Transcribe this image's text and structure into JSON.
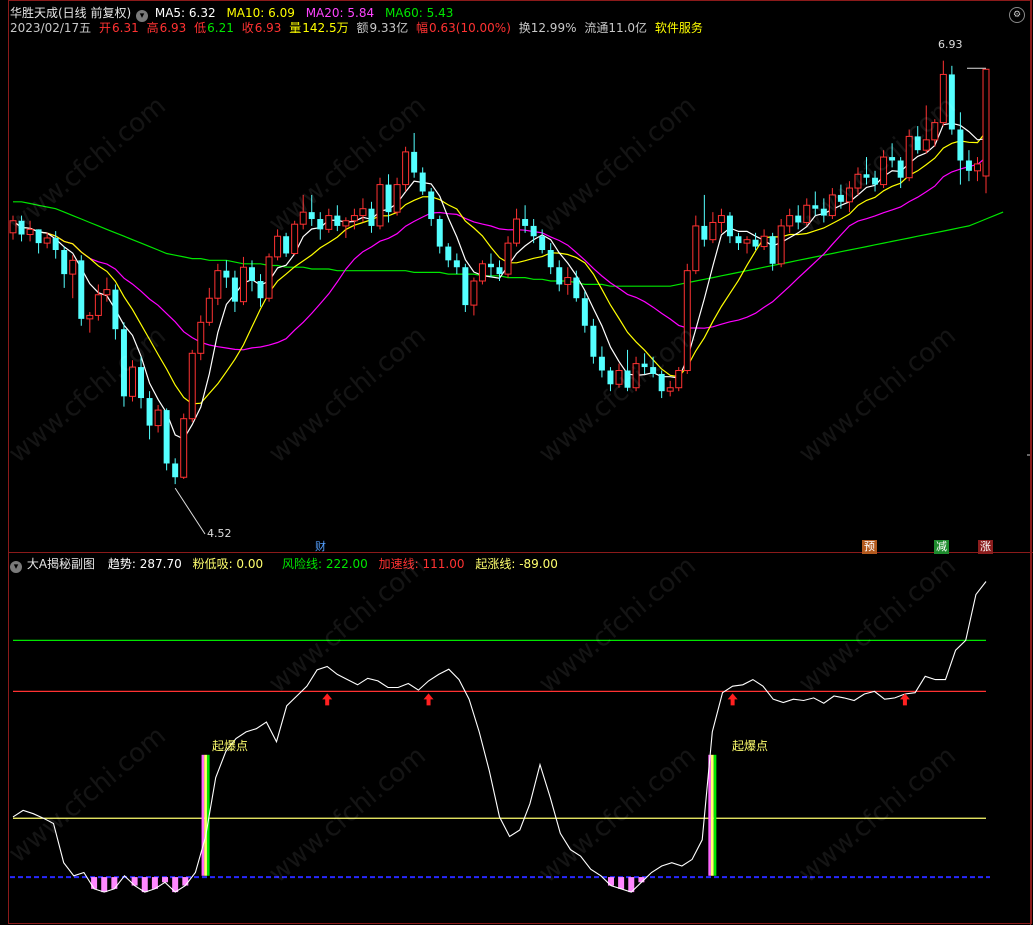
{
  "main_header": {
    "title": "华胜天成(日线 前复权)",
    "ma5": "MA5: 6.32",
    "ma10": "MA10: 6.09",
    "ma20": "MA20: 5.84",
    "ma60": "MA60: 5.43",
    "date": "2023/02/17五",
    "open_label": "开",
    "open": "6.31",
    "high_label": "高",
    "high": "6.93",
    "low_label": "低",
    "low": "6.21",
    "close_label": "收",
    "close": "6.93",
    "vol_label": "量",
    "vol": "142.5万",
    "amt_label": "额",
    "amt": "9.33亿",
    "chg_label": "幅",
    "chg": "0.63(10.00%)",
    "turnover": "换12.99%",
    "float": "流通11.0亿",
    "service": "软件服务"
  },
  "markers": {
    "high_price": "6.93",
    "low_price": "4.52",
    "cai": "财",
    "yu": "预",
    "jian": "减",
    "zhang": "涨"
  },
  "sub_header": {
    "title": "大A揭秘副图",
    "trend": "趋势: 287.70",
    "pink": "粉低吸: 0.00",
    "risk": "风险线: 222.00",
    "accel": "加速线: 111.00",
    "rise": "起涨线: -89.00"
  },
  "signals": {
    "qibao1": "起爆点",
    "qibao2": "起爆点"
  },
  "watermark": "www.cfchi.com",
  "colors": {
    "up": "#ff3232",
    "down": "#54ffff",
    "ma5": "#ffffff",
    "ma10": "#ffff00",
    "ma20": "#ff00ff",
    "ma60": "#00e600",
    "risk": "#00e600",
    "accel": "#ff3232",
    "rise": "#ffff6e"
  },
  "chart_data": [
    {
      "type": "candlestick",
      "title": "华胜天成(日线 前复权)",
      "ylim": [
        4.3,
        7.1
      ],
      "series": [
        {
          "name": "K",
          "ohlc": [
            [
              5.98,
              6.08,
              5.94,
              6.05
            ],
            [
              6.05,
              6.08,
              5.93,
              5.97
            ],
            [
              5.97,
              6.05,
              5.93,
              6.0
            ],
            [
              6.0,
              6.0,
              5.86,
              5.92
            ],
            [
              5.92,
              5.98,
              5.89,
              5.95
            ],
            [
              5.95,
              5.99,
              5.83,
              5.88
            ],
            [
              5.88,
              5.9,
              5.66,
              5.74
            ],
            [
              5.74,
              5.85,
              5.6,
              5.82
            ],
            [
              5.82,
              5.85,
              5.44,
              5.48
            ],
            [
              5.48,
              5.52,
              5.4,
              5.5
            ],
            [
              5.5,
              5.68,
              5.47,
              5.62
            ],
            [
              5.62,
              5.72,
              5.58,
              5.65
            ],
            [
              5.65,
              5.68,
              5.36,
              5.42
            ],
            [
              5.42,
              5.46,
              4.97,
              5.03
            ],
            [
              5.03,
              5.24,
              5.0,
              5.2
            ],
            [
              5.2,
              5.26,
              4.96,
              5.02
            ],
            [
              5.02,
              5.06,
              4.78,
              4.86
            ],
            [
              4.86,
              4.98,
              4.82,
              4.95
            ],
            [
              4.95,
              4.96,
              4.6,
              4.64
            ],
            [
              4.64,
              4.67,
              4.52,
              4.56
            ],
            [
              4.56,
              4.93,
              4.55,
              4.9
            ],
            [
              4.9,
              5.3,
              4.88,
              5.28
            ],
            [
              5.28,
              5.5,
              5.24,
              5.46
            ],
            [
              5.46,
              5.66,
              5.44,
              5.6
            ],
            [
              5.6,
              5.8,
              5.56,
              5.76
            ],
            [
              5.76,
              5.82,
              5.66,
              5.72
            ],
            [
              5.72,
              5.76,
              5.52,
              5.58
            ],
            [
              5.58,
              5.84,
              5.56,
              5.78
            ],
            [
              5.78,
              5.82,
              5.64,
              5.7
            ],
            [
              5.7,
              5.74,
              5.55,
              5.6
            ],
            [
              5.6,
              5.86,
              5.58,
              5.84
            ],
            [
              5.84,
              6.0,
              5.82,
              5.96
            ],
            [
              5.96,
              5.98,
              5.84,
              5.86
            ],
            [
              5.86,
              6.05,
              5.85,
              6.03
            ],
            [
              6.03,
              6.2,
              6.0,
              6.1
            ],
            [
              6.1,
              6.2,
              6.02,
              6.06
            ],
            [
              6.06,
              6.1,
              5.94,
              6.0
            ],
            [
              6.0,
              6.12,
              5.98,
              6.08
            ],
            [
              6.08,
              6.14,
              5.99,
              6.02
            ],
            [
              6.02,
              6.07,
              5.95,
              6.05
            ],
            [
              6.05,
              6.12,
              6.0,
              6.08
            ],
            [
              6.08,
              6.18,
              6.04,
              6.12
            ],
            [
              6.12,
              6.16,
              5.98,
              6.02
            ],
            [
              6.02,
              6.3,
              6.0,
              6.26
            ],
            [
              6.26,
              6.32,
              6.04,
              6.1
            ],
            [
              6.1,
              6.3,
              6.08,
              6.26
            ],
            [
              6.26,
              6.48,
              6.22,
              6.45
            ],
            [
              6.45,
              6.56,
              6.3,
              6.33
            ],
            [
              6.33,
              6.36,
              6.2,
              6.22
            ],
            [
              6.22,
              6.24,
              6.02,
              6.06
            ],
            [
              6.06,
              6.08,
              5.86,
              5.9
            ],
            [
              5.9,
              5.92,
              5.78,
              5.82
            ],
            [
              5.82,
              5.86,
              5.74,
              5.78
            ],
            [
              5.78,
              5.8,
              5.52,
              5.56
            ],
            [
              5.56,
              5.72,
              5.5,
              5.7
            ],
            [
              5.7,
              5.82,
              5.68,
              5.8
            ],
            [
              5.8,
              5.86,
              5.72,
              5.78
            ],
            [
              5.78,
              5.82,
              5.7,
              5.74
            ],
            [
              5.74,
              5.96,
              5.72,
              5.92
            ],
            [
              5.92,
              6.12,
              5.9,
              6.06
            ],
            [
              6.06,
              6.14,
              5.98,
              6.02
            ],
            [
              6.02,
              6.06,
              5.92,
              5.96
            ],
            [
              5.96,
              6.0,
              5.86,
              5.88
            ],
            [
              5.88,
              5.92,
              5.74,
              5.78
            ],
            [
              5.78,
              5.82,
              5.64,
              5.68
            ],
            [
              5.68,
              5.78,
              5.62,
              5.72
            ],
            [
              5.72,
              5.76,
              5.58,
              5.6
            ],
            [
              5.6,
              5.64,
              5.4,
              5.44
            ],
            [
              5.44,
              5.48,
              5.22,
              5.26
            ],
            [
              5.26,
              5.32,
              5.14,
              5.18
            ],
            [
              5.18,
              5.2,
              5.06,
              5.1
            ],
            [
              5.1,
              5.22,
              5.08,
              5.18
            ],
            [
              5.18,
              5.3,
              5.06,
              5.08
            ],
            [
              5.08,
              5.26,
              5.06,
              5.22
            ],
            [
              5.22,
              5.28,
              5.16,
              5.2
            ],
            [
              5.2,
              5.26,
              5.14,
              5.16
            ],
            [
              5.16,
              5.18,
              5.02,
              5.06
            ],
            [
              5.06,
              5.12,
              5.03,
              5.08
            ],
            [
              5.08,
              5.2,
              5.06,
              5.18
            ],
            [
              5.18,
              5.8,
              5.16,
              5.76
            ],
            [
              5.76,
              6.08,
              5.74,
              6.02
            ],
            [
              6.02,
              6.2,
              5.9,
              5.94
            ],
            [
              5.94,
              6.1,
              5.92,
              6.04
            ],
            [
              6.04,
              6.12,
              5.98,
              6.08
            ],
            [
              6.08,
              6.1,
              5.92,
              5.96
            ],
            [
              5.96,
              5.98,
              5.88,
              5.92
            ],
            [
              5.92,
              5.96,
              5.86,
              5.94
            ],
            [
              5.94,
              5.98,
              5.88,
              5.9
            ],
            [
              5.9,
              6.0,
              5.88,
              5.96
            ],
            [
              5.96,
              5.98,
              5.76,
              5.8
            ],
            [
              5.8,
              6.06,
              5.78,
              6.02
            ],
            [
              6.02,
              6.12,
              5.98,
              6.08
            ],
            [
              6.08,
              6.14,
              6.0,
              6.04
            ],
            [
              6.04,
              6.18,
              6.02,
              6.14
            ],
            [
              6.14,
              6.22,
              6.08,
              6.12
            ],
            [
              6.12,
              6.18,
              6.04,
              6.08
            ],
            [
              6.08,
              6.24,
              6.06,
              6.2
            ],
            [
              6.2,
              6.26,
              6.12,
              6.16
            ],
            [
              6.16,
              6.28,
              6.1,
              6.24
            ],
            [
              6.24,
              6.36,
              6.2,
              6.32
            ],
            [
              6.32,
              6.42,
              6.26,
              6.3
            ],
            [
              6.3,
              6.34,
              6.22,
              6.26
            ],
            [
              6.26,
              6.46,
              6.24,
              6.42
            ],
            [
              6.42,
              6.5,
              6.36,
              6.4
            ],
            [
              6.4,
              6.42,
              6.24,
              6.3
            ],
            [
              6.3,
              6.58,
              6.28,
              6.54
            ],
            [
              6.54,
              6.6,
              6.44,
              6.46
            ],
            [
              6.46,
              6.72,
              6.44,
              6.52
            ],
            [
              6.52,
              6.64,
              6.48,
              6.62
            ],
            [
              6.62,
              6.98,
              6.6,
              6.9
            ],
            [
              6.9,
              6.95,
              6.55,
              6.58
            ],
            [
              6.58,
              6.68,
              6.26,
              6.4
            ],
            [
              6.4,
              6.46,
              6.28,
              6.34
            ],
            [
              6.34,
              6.42,
              6.28,
              6.38
            ],
            [
              6.31,
              6.93,
              6.21,
              6.93
            ]
          ]
        },
        {
          "name": "MA60",
          "values": [
            6.16,
            6.16,
            6.15,
            6.14,
            6.13,
            6.12,
            6.1,
            6.08,
            6.06,
            6.04,
            6.02,
            6.0,
            5.98,
            5.96,
            5.94,
            5.92,
            5.9,
            5.88,
            5.86,
            5.85,
            5.84,
            5.83,
            5.83,
            5.82,
            5.82,
            5.82,
            5.81,
            5.8,
            5.8,
            5.8,
            5.79,
            5.79,
            5.78,
            5.78,
            5.78,
            5.77,
            5.77,
            5.77,
            5.76,
            5.76,
            5.76,
            5.76,
            5.76,
            5.76,
            5.76,
            5.76,
            5.76,
            5.75,
            5.75,
            5.75,
            5.75,
            5.74,
            5.74,
            5.74,
            5.74,
            5.73,
            5.73,
            5.73,
            5.72,
            5.72,
            5.72,
            5.71,
            5.71,
            5.7,
            5.7,
            5.7,
            5.69,
            5.68,
            5.68,
            5.68,
            5.67,
            5.67,
            5.67,
            5.67,
            5.67,
            5.67,
            5.67,
            5.67,
            5.68,
            5.69,
            5.7,
            5.71,
            5.72,
            5.73,
            5.74,
            5.75,
            5.76,
            5.77,
            5.78,
            5.79,
            5.8,
            5.81,
            5.82,
            5.83,
            5.84,
            5.85,
            5.86,
            5.87,
            5.88,
            5.89,
            5.9,
            5.91,
            5.92,
            5.93,
            5.94,
            5.95,
            5.96,
            5.97,
            5.98,
            5.99,
            6.0,
            6.01,
            6.02,
            6.04,
            6.06,
            6.08,
            6.1
          ]
        }
      ]
    },
    {
      "type": "line",
      "title": "大A揭秘副图",
      "ylim": [
        -120,
        400
      ],
      "series": [
        {
          "name": "趋势",
          "values": [
            30,
            40,
            35,
            28,
            20,
            -40,
            -60,
            -55,
            -80,
            -85,
            -80,
            -60,
            -75,
            -85,
            -80,
            -70,
            -85,
            -75,
            -55,
            0,
            90,
            130,
            150,
            160,
            165,
            175,
            145,
            200,
            215,
            230,
            255,
            260,
            248,
            240,
            232,
            242,
            238,
            228,
            228,
            234,
            224,
            238,
            248,
            256,
            240,
            210,
            160,
            100,
            30,
            0,
            10,
            50,
            110,
            60,
            5,
            -20,
            -30,
            -50,
            -60,
            -75,
            -80,
            -85,
            -70,
            -55,
            -45,
            -40,
            -45,
            -35,
            -5,
            160,
            220,
            230,
            232,
            240,
            230,
            210,
            205,
            210,
            208,
            212,
            204,
            215,
            212,
            208,
            218,
            222,
            210,
            212,
            218,
            220,
            245,
            240,
            240,
            285,
            300,
            370,
            390
          ]
        }
      ]
    }
  ]
}
